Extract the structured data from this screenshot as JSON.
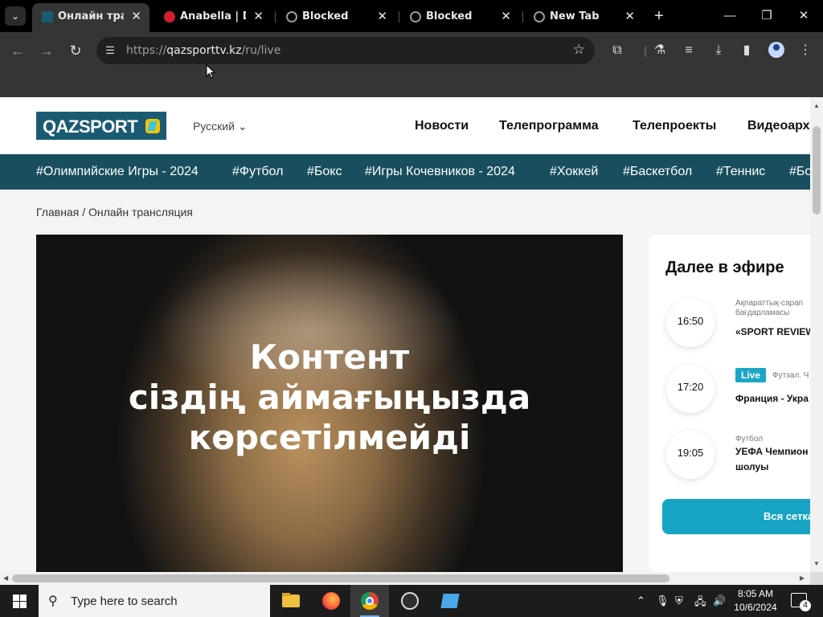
{
  "browser": {
    "tabs": [
      {
        "title": "Онлайн трансл",
        "active": true,
        "favicon_color": "#1a5b73"
      },
      {
        "title": "Anabella | Dok",
        "active": false,
        "favicon_color": "#d02030"
      },
      {
        "title": "Blocked",
        "active": false,
        "favicon_color": "#9a9a9a"
      },
      {
        "title": "Blocked",
        "active": false,
        "favicon_color": "#9a9a9a"
      },
      {
        "title": "New Tab",
        "active": false,
        "favicon_color": "#9a9a9a"
      }
    ],
    "url_host": "qazsporttv.kz",
    "url_path": "/ru/live",
    "url_scheme": "https://"
  },
  "site": {
    "logo": "QAZSPORT",
    "language": "Русский",
    "nav": [
      "Новости",
      "Телепрограмма",
      "Телепроекты",
      "Видеоарх"
    ],
    "hashtags": [
      "#Олимпийские Игры - 2024",
      "#Футбол",
      "#Бокс",
      "#Игры Кочевников - 2024",
      "#Хоккей",
      "#Баскетбол",
      "#Теннис",
      "#Бо"
    ],
    "breadcrumb": {
      "home": "Главная",
      "separator": "/",
      "current": "Онлайн трансляция"
    },
    "player_message": [
      "Контент",
      "сіздің аймағыңызда",
      "көрсетілмейді"
    ],
    "up_next": {
      "title": "Далее в эфире",
      "items": [
        {
          "time": "16:50",
          "category": "Ақпараттық-сарап бағдарламасы",
          "name": "«SPORT REVIEW",
          "live": false
        },
        {
          "time": "17:20",
          "category": "Футзал. Ч орын үшін матч",
          "name": "Франция - Укра",
          "live": true,
          "live_label": "Live"
        },
        {
          "time": "19:05",
          "category": "Футбол",
          "name_lines": [
            "УЕФА Чемпион",
            "шолуы"
          ],
          "live": false
        }
      ],
      "all_button": "Вся сетка"
    }
  },
  "taskbar": {
    "search_placeholder": "Type here to search",
    "time": "8:05 AM",
    "date": "10/6/2024",
    "notification_count": "4"
  },
  "colors": {
    "brand_dark": "#184e5e",
    "brand_accent": "#17a4c4",
    "logo_yellow": "#f5c400"
  }
}
